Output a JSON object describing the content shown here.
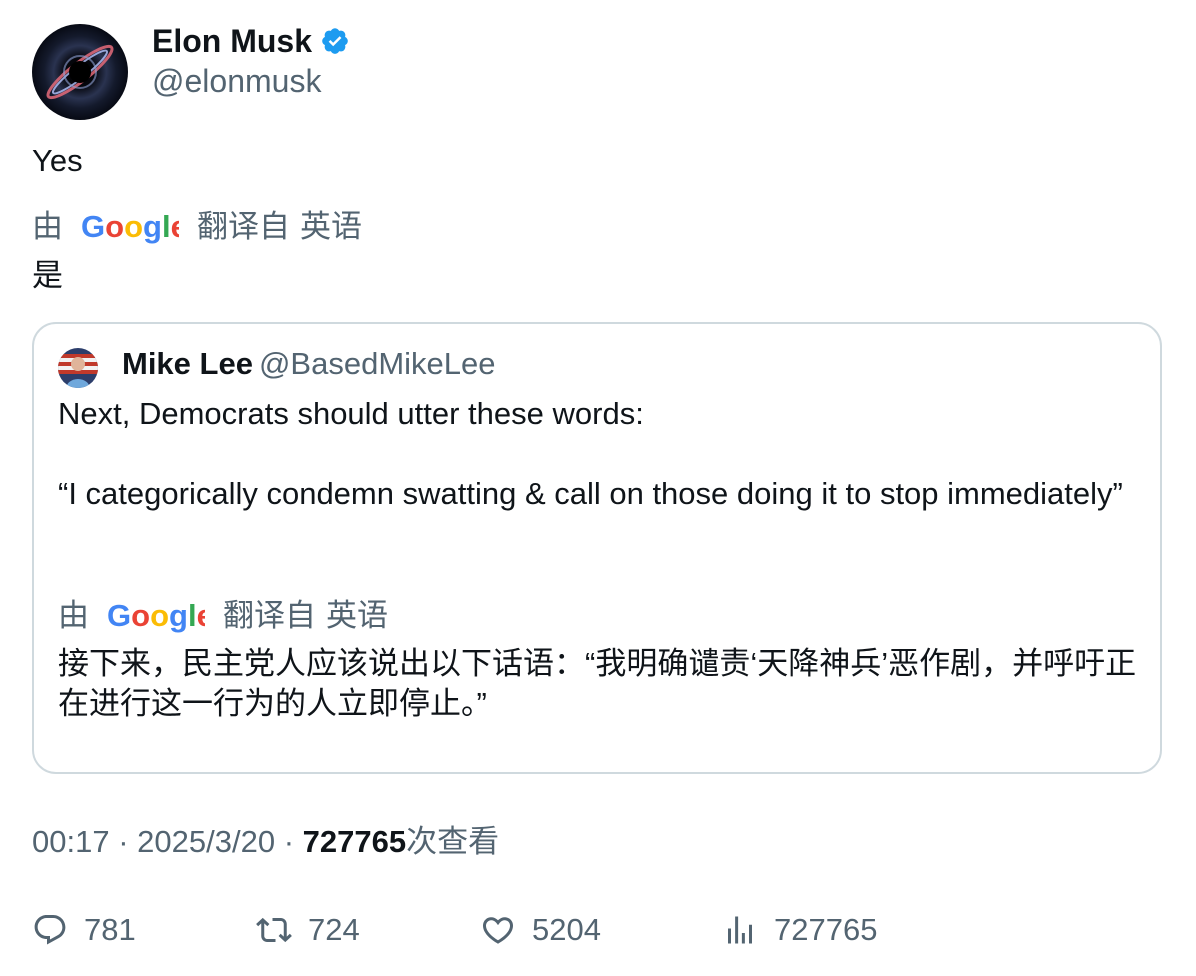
{
  "author": {
    "name": "Elon Musk",
    "handle": "@elonmusk",
    "verified_icon": "verified-badge-icon",
    "verified_color": "#1d9bf0"
  },
  "tweet": {
    "text": "Yes",
    "translation": {
      "by_label": "由",
      "provider": "Google",
      "translated_from": "翻译自",
      "language": "英语",
      "text": "是"
    }
  },
  "quote": {
    "name": "Mike Lee",
    "handle": "@BasedMikeLee",
    "text": "Next, Democrats should utter these words:\n\n“I categorically condemn swatting & call on those doing it to stop immediately”",
    "translation": {
      "by_label": "由",
      "provider": "Google",
      "translated_from": "翻译自",
      "language": "英语",
      "text": "接下来，民主党人应该说出以下话语：“我明确谴责‘天降神兵’恶作剧，并呼吁正在进行这一行为的人立即停止。”"
    }
  },
  "meta": {
    "time": "00:17",
    "separator": "·",
    "date": "2025/3/20",
    "views_count": "727765",
    "views_label": "次查看"
  },
  "actions": {
    "replies": "781",
    "retweets": "724",
    "likes": "5204",
    "views": "727765"
  },
  "colors": {
    "text": "#0f1419",
    "secondary": "#536471",
    "border": "#cfd9de",
    "google_blue": "#4285F4",
    "google_red": "#EA4335",
    "google_yellow": "#FBBC05",
    "google_green": "#34A853"
  }
}
